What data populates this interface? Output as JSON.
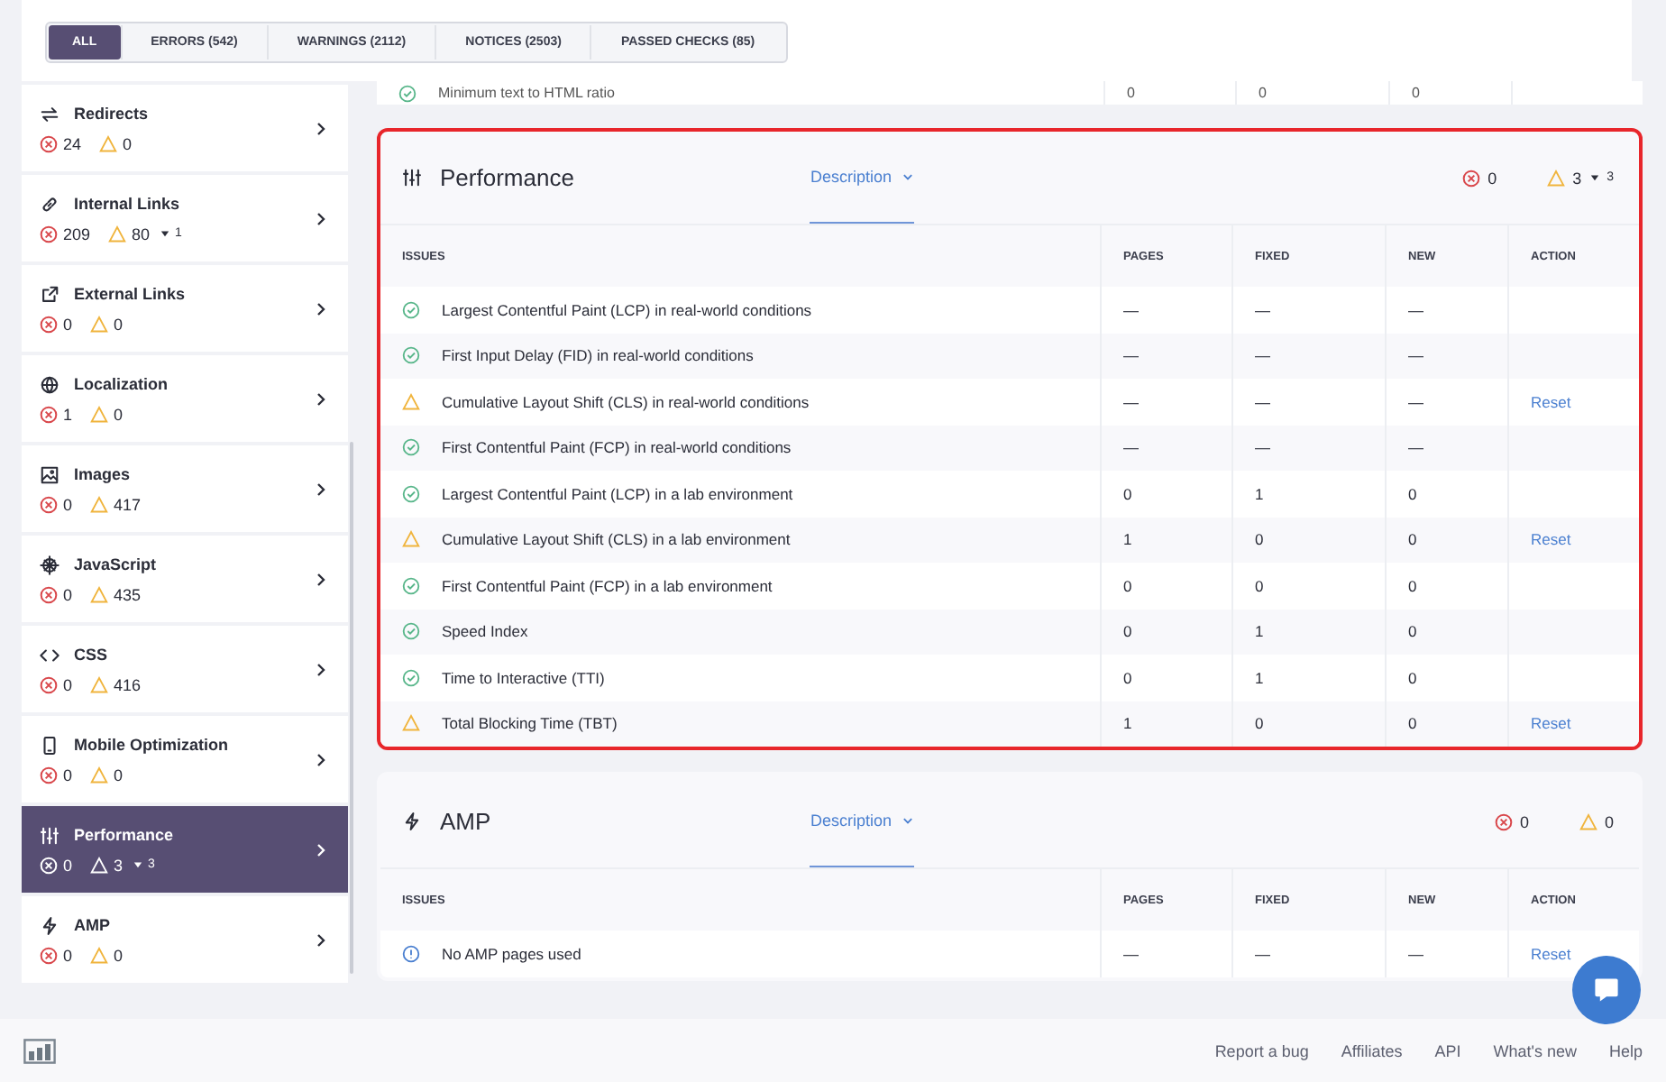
{
  "filter_tabs": [
    {
      "label": "ALL",
      "selected": true
    },
    {
      "label": "ERRORS (542)",
      "selected": false
    },
    {
      "label": "WARNINGS (2112)",
      "selected": false
    },
    {
      "label": "NOTICES (2503)",
      "selected": false
    },
    {
      "label": "PASSED CHECKS (85)",
      "selected": false
    }
  ],
  "sidebar": {
    "items": [
      {
        "title": "Redirects",
        "kind": "redirect",
        "errors": "24",
        "warnings": "0",
        "selected": false
      },
      {
        "title": "Internal Links",
        "kind": "link",
        "errors": "209",
        "warnings": "80",
        "new_warnings": "1",
        "selected": false
      },
      {
        "title": "External Links",
        "kind": "external",
        "errors": "0",
        "warnings": "0",
        "selected": false
      },
      {
        "title": "Localization",
        "kind": "globe",
        "errors": "1",
        "warnings": "0",
        "selected": false
      },
      {
        "title": "Images",
        "kind": "image",
        "errors": "0",
        "warnings": "417",
        "selected": false
      },
      {
        "title": "JavaScript",
        "kind": "script",
        "errors": "0",
        "warnings": "435",
        "selected": false
      },
      {
        "title": "CSS",
        "kind": "code",
        "errors": "0",
        "warnings": "416",
        "selected": false
      },
      {
        "title": "Mobile Optimization",
        "kind": "mobile",
        "errors": "0",
        "warnings": "0",
        "selected": false
      },
      {
        "title": "Performance",
        "kind": "sliders",
        "errors": "0",
        "warnings": "3",
        "new_warnings": "3",
        "selected": true
      },
      {
        "title": "AMP",
        "kind": "bolt",
        "errors": "0",
        "warnings": "0",
        "selected": false
      }
    ]
  },
  "previous_row": {
    "kind": "passed",
    "issue": "Minimum text to HTML ratio",
    "pages": "0",
    "fixed": "0",
    "new": "0"
  },
  "sections": [
    {
      "title": "Performance",
      "kind": "sliders",
      "highlighted": true,
      "description_label": "Description",
      "errors": "0",
      "warnings": "3",
      "new_warnings": "3",
      "columns": [
        "ISSUES",
        "PAGES",
        "FIXED",
        "NEW",
        "ACTION"
      ],
      "rows": [
        {
          "kind": "passed",
          "issue": "Largest Contentful Paint (LCP) in real-world conditions",
          "pages": "—",
          "fixed": "—",
          "new": "—"
        },
        {
          "kind": "passed",
          "issue": "First Input Delay (FID) in real-world conditions",
          "pages": "—",
          "fixed": "—",
          "new": "—"
        },
        {
          "kind": "warning",
          "issue": "Cumulative Layout Shift (CLS) in real-world conditions",
          "pages": "—",
          "fixed": "—",
          "new": "—",
          "action": "Reset"
        },
        {
          "kind": "passed",
          "issue": "First Contentful Paint (FCP) in real-world conditions",
          "pages": "—",
          "fixed": "—",
          "new": "—"
        },
        {
          "kind": "passed",
          "issue": "Largest Contentful Paint (LCP) in a lab environment",
          "pages": "0",
          "fixed": "1",
          "new": "0"
        },
        {
          "kind": "warning",
          "issue": "Cumulative Layout Shift (CLS) in a lab environment",
          "pages": "1",
          "fixed": "0",
          "new": "0",
          "action": "Reset"
        },
        {
          "kind": "passed",
          "issue": "First Contentful Paint (FCP) in a lab environment",
          "pages": "0",
          "fixed": "0",
          "new": "0"
        },
        {
          "kind": "passed",
          "issue": "Speed Index",
          "pages": "0",
          "fixed": "1",
          "new": "0"
        },
        {
          "kind": "passed",
          "issue": "Time to Interactive (TTI)",
          "pages": "0",
          "fixed": "1",
          "new": "0"
        },
        {
          "kind": "warning",
          "issue": "Total Blocking Time (TBT)",
          "pages": "1",
          "fixed": "0",
          "new": "0",
          "action": "Reset"
        }
      ]
    },
    {
      "title": "AMP",
      "kind": "bolt",
      "highlighted": false,
      "description_label": "Description",
      "errors": "0",
      "warnings": "0",
      "columns": [
        "ISSUES",
        "PAGES",
        "FIXED",
        "NEW",
        "ACTION"
      ],
      "rows": [
        {
          "kind": "notice",
          "issue": "No AMP pages used",
          "pages": "—",
          "fixed": "—",
          "new": "—",
          "action": "Reset"
        }
      ]
    }
  ],
  "footer": {
    "links": [
      "Report a bug",
      "Affiliates",
      "API",
      "What's new",
      "Help"
    ]
  }
}
